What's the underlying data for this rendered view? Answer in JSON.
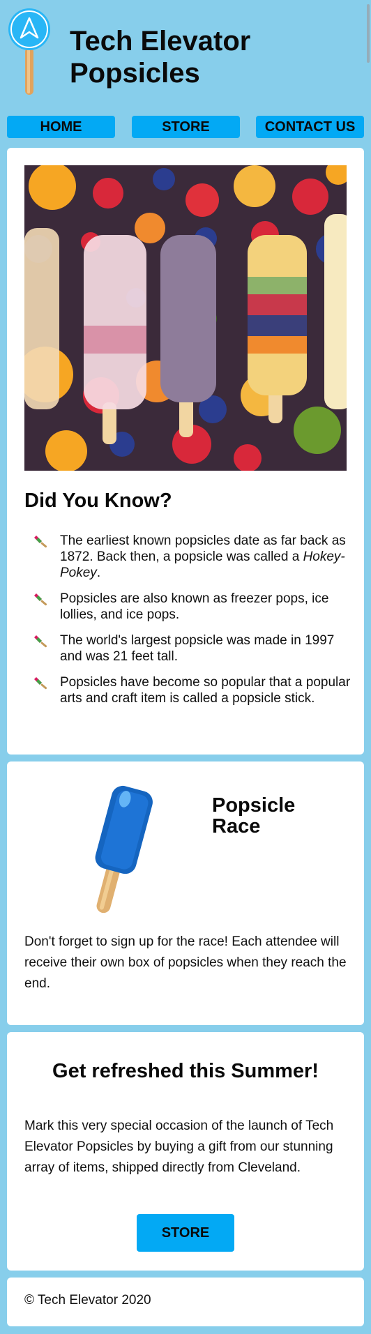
{
  "header": {
    "title_line1": "Tech Elevator",
    "title_line2": "Popsicles"
  },
  "nav": {
    "items": [
      {
        "label": "HOME"
      },
      {
        "label": "STORE"
      },
      {
        "label": "CONTACT US"
      }
    ]
  },
  "did_you_know": {
    "title": "Did You Know?",
    "facts": [
      {
        "text": "The earliest known popsicles date as far back as 1872. Back then, a popsicle was called a ",
        "emphasis": "Hokey-Pokey",
        "suffix": "."
      },
      {
        "text": "Popsicles are also known as freezer pops, ice lollies, and ice pops."
      },
      {
        "text": "The world's largest popsicle was made in 1997 and was 21 feet tall."
      },
      {
        "text": "Popsicles have become so popular that a popular arts and craft item is called a popsicle stick."
      }
    ]
  },
  "race": {
    "title": "Popsicle Race",
    "text": "Don't forget to sign up for the race! Each attendee will receive their own box of popsicles when they reach the end."
  },
  "summer": {
    "title": "Get refreshed this Summer!",
    "text": "Mark this very special occasion of the launch of Tech Elevator Popsicles by buying a gift from our stunning array of items, shipped directly from Cleveland.",
    "button_label": "STORE"
  },
  "footer": {
    "copyright": "© Tech Elevator 2020"
  },
  "colors": {
    "background": "#87ceeb",
    "button": "#03a9f4",
    "card": "#ffffff"
  },
  "icons": [
    "logo-icon",
    "popsicle-bullet-icon",
    "blue-popsicle-icon",
    "popsicles-photo"
  ]
}
